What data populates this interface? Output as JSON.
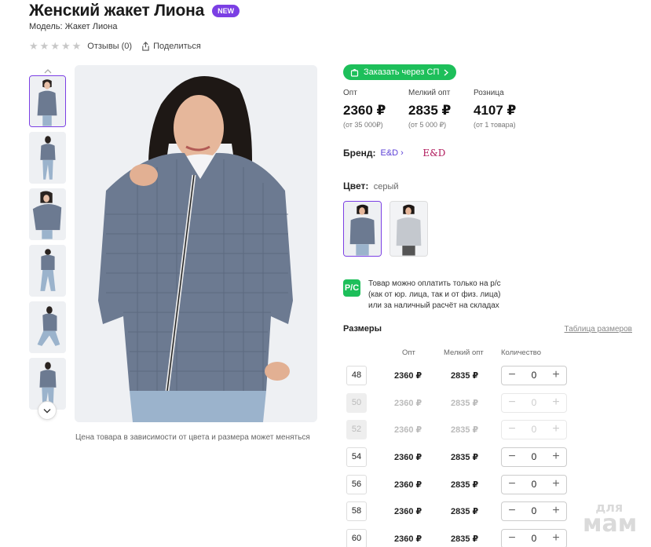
{
  "product": {
    "title": "Женский жакет Лиона",
    "badge": "NEW",
    "model": "Модель: Жакет Лиона",
    "reviews": "Отзывы (0)",
    "share": "Поделиться",
    "rating": 0
  },
  "gallery": {
    "price_note": "Цена товара в зависимости от цвета и размера может меняться"
  },
  "order_button": "Заказать через СП",
  "prices": [
    {
      "label": "Опт",
      "value": "2360 ₽",
      "sub": "(от 35 000₽)"
    },
    {
      "label": "Мелкий опт",
      "value": "2835 ₽",
      "sub": "(от 5 000 ₽)"
    },
    {
      "label": "Розница",
      "value": "4107 ₽",
      "sub": "(от 1 товара)"
    }
  ],
  "brand": {
    "label": "Бренд:",
    "name": "E&D",
    "logo_text": "E&D"
  },
  "color": {
    "label": "Цвет:",
    "value": "серый"
  },
  "payment_note": [
    "Товар можно оплатить только на р/с",
    "(как от юр. лица, так и от физ. лица)",
    "или за наличный расчёт на складах"
  ],
  "payment_icon": "Р/С",
  "sizes": {
    "title": "Размеры",
    "table_link": "Таблица размеров",
    "col_opt": "Опт",
    "col_small_opt": "Мелкий опт",
    "col_qty": "Количество",
    "rows": [
      {
        "size": "48",
        "opt": "2360 ₽",
        "small": "2835 ₽",
        "qty": "0"
      },
      {
        "size": "50",
        "opt": "2360 ₽",
        "small": "2835 ₽",
        "qty": "0"
      },
      {
        "size": "52",
        "opt": "2360 ₽",
        "small": "2835 ₽",
        "qty": "0"
      },
      {
        "size": "54",
        "opt": "2360 ₽",
        "small": "2835 ₽",
        "qty": "0"
      },
      {
        "size": "56",
        "opt": "2360 ₽",
        "small": "2835 ₽",
        "qty": "0"
      },
      {
        "size": "58",
        "opt": "2360 ₽",
        "small": "2835 ₽",
        "qty": "0"
      },
      {
        "size": "60",
        "opt": "2360 ₽",
        "small": "2835 ₽",
        "qty": "0"
      }
    ]
  },
  "watermark": {
    "line1": "для",
    "line2": "мам"
  },
  "colors": {
    "accent": "#7b3fe4",
    "green": "#1dbf5a",
    "jacket": "#6c7a91"
  }
}
